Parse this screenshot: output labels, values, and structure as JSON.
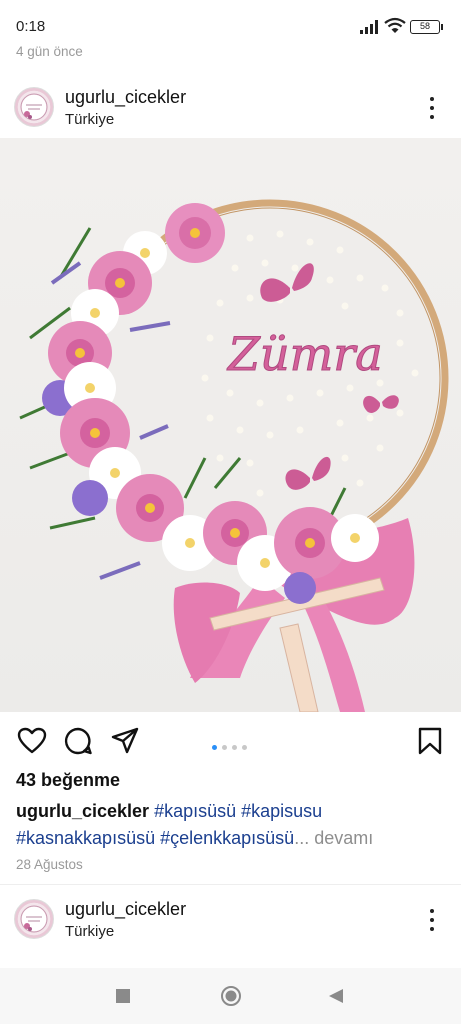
{
  "status_bar": {
    "time": "0:18",
    "battery": "58"
  },
  "post_age": "4 gün önce",
  "post1": {
    "username": "ugurlu_cicekler",
    "location": "Türkiye",
    "image_text": "Zümra",
    "likes": "43 beğenme",
    "caption_user": "ugurlu_cicekler",
    "caption_tags_line1": "#kapısüsü #kapisusu",
    "caption_tags_line2": "#kasnakkapısüsü #çelenkkapısüsü",
    "ellipsis": "...",
    "more_label": "devamı",
    "date": "28 Ağustos"
  },
  "post2": {
    "username": "ugurlu_cicekler",
    "location": "Türkiye"
  },
  "carousel": {
    "count": 4,
    "active": 0
  },
  "colors": {
    "accent_blue": "#2a8ff7",
    "hashtag": "#1b3f8f",
    "pink": "#d4609a"
  },
  "icons": [
    "heart-icon",
    "comment-icon",
    "share-icon",
    "bookmark-icon",
    "more-icon",
    "nav-square-icon",
    "nav-circle-icon",
    "nav-back-icon"
  ]
}
